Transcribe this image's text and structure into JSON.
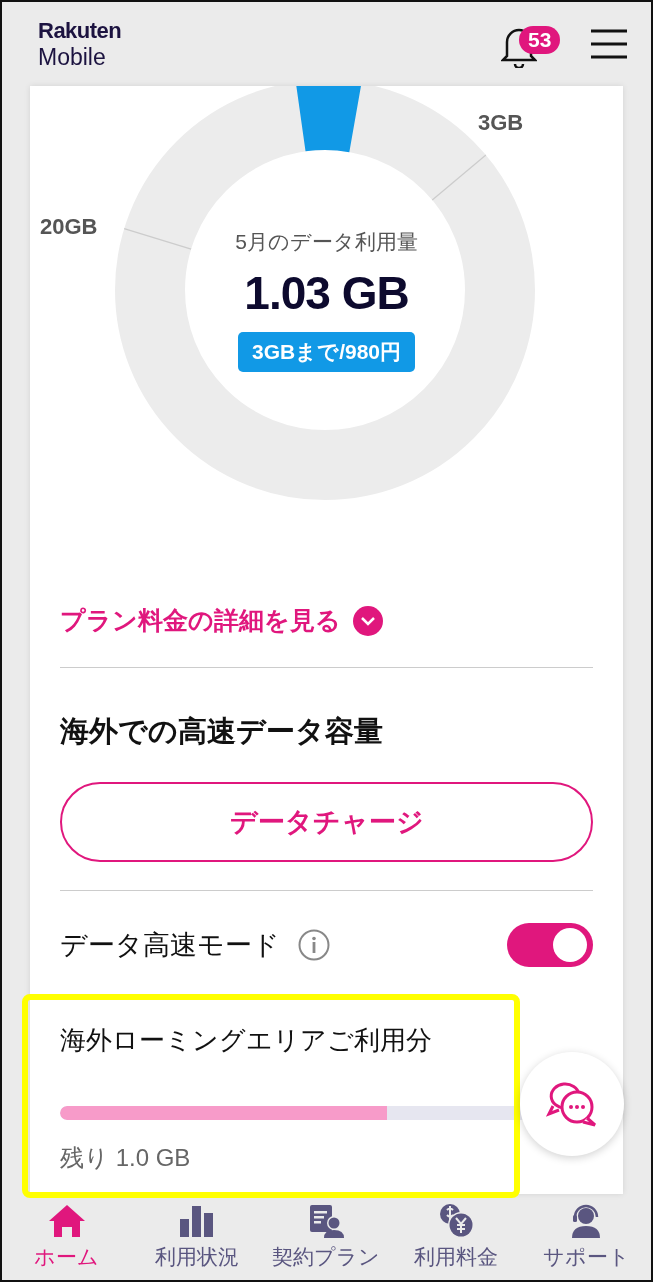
{
  "header": {
    "logo_line_1": "Rakuten",
    "logo_line_2": "Mobile",
    "notification_count": "53"
  },
  "usage": {
    "gauge_labels": [
      "3GB",
      "20GB"
    ],
    "month_label": "5月のデータ利用量",
    "amount": "1.03 GB",
    "plan_badge": "3GBまで/980円"
  },
  "plan_link": "プラン料金の詳細を見る",
  "overseas": {
    "heading": "海外での高速データ容量",
    "charge_button": "データチャージ"
  },
  "high_speed_mode": {
    "label": "データ高速モード",
    "on": true
  },
  "roaming": {
    "title": "海外ローミングエリアご利用分",
    "level": 0.58,
    "remaining": "残り 1.0 GB"
  },
  "nav": [
    {
      "label": "ホーム",
      "selected": true
    },
    {
      "label": "利用状況",
      "selected": false
    },
    {
      "label": "契約プラン",
      "selected": false
    },
    {
      "label": "利用料金",
      "selected": false
    },
    {
      "label": "サポート",
      "selected": false
    }
  ]
}
